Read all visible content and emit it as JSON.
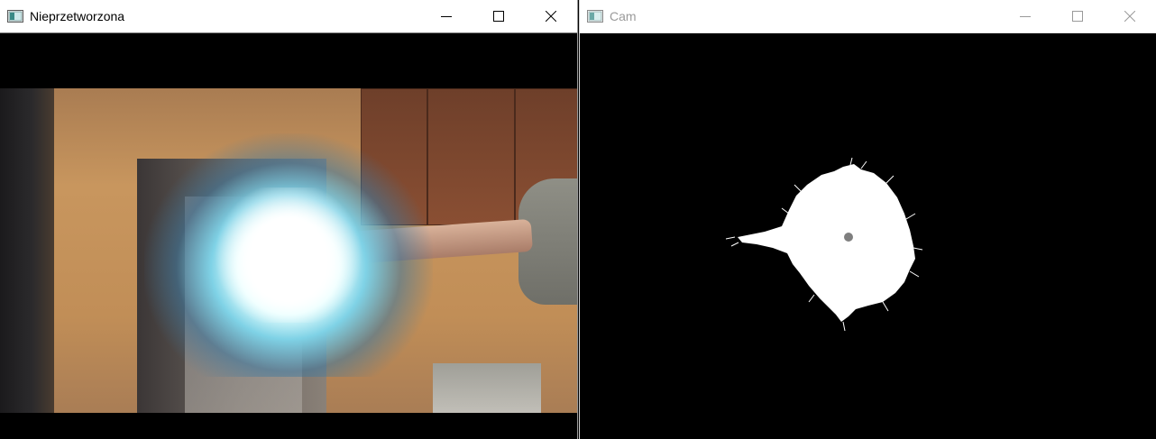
{
  "windows": {
    "left": {
      "title": "Nieprzetworzona",
      "active": true,
      "icon": "opencv-window-icon",
      "controls": {
        "minimize": "minimize-icon",
        "maximize": "maximize-icon",
        "close": "close-icon"
      },
      "content": "raw webcam frame with bright light glare"
    },
    "right": {
      "title": "Cam",
      "active": false,
      "icon": "opencv-window-icon",
      "controls": {
        "minimize": "minimize-icon",
        "maximize": "maximize-icon",
        "close": "close-icon"
      },
      "content": "binary threshold mask with white blob and gray centroid dot"
    }
  },
  "colors": {
    "titlebar_bg": "#ffffff",
    "title_active": "#000000",
    "title_inactive": "#9a9a9a",
    "content_bg": "#000000",
    "mask_blob": "#ffffff",
    "centroid": "#7f7f7f"
  }
}
